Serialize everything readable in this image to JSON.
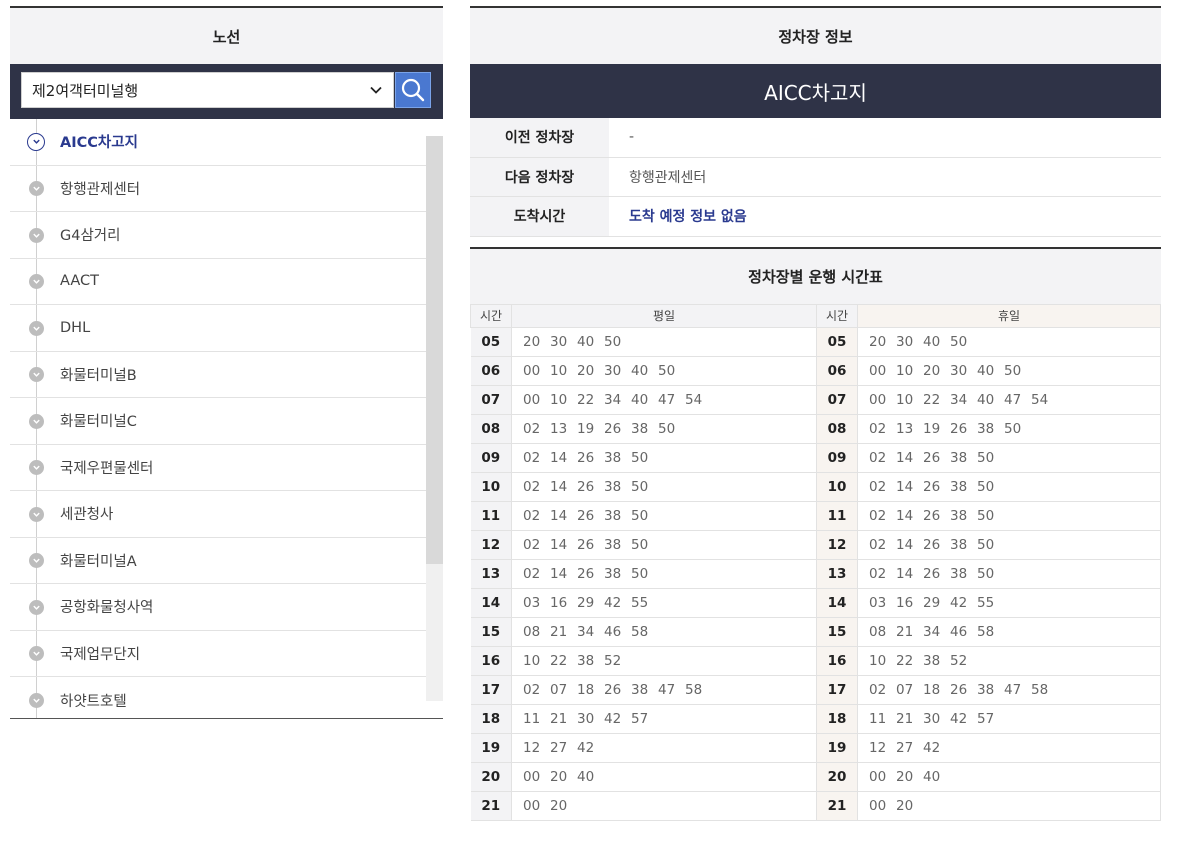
{
  "left": {
    "title": "노선",
    "route_select": "제2여객터미널행",
    "stops": [
      {
        "label": "AICC차고지",
        "active": true
      },
      {
        "label": "항행관제센터"
      },
      {
        "label": "G4삼거리"
      },
      {
        "label": "AACT"
      },
      {
        "label": "DHL"
      },
      {
        "label": "화물터미널B"
      },
      {
        "label": "화물터미널C"
      },
      {
        "label": "국제우편물센터"
      },
      {
        "label": "세관청사"
      },
      {
        "label": "화물터미널A"
      },
      {
        "label": "공항화물청사역"
      },
      {
        "label": "국제업무단지"
      },
      {
        "label": "하얏트호텔"
      }
    ]
  },
  "right": {
    "title": "정차장 정보",
    "stop_name": "AICC차고지",
    "info": [
      {
        "key": "이전 정차장",
        "value": "-"
      },
      {
        "key": "다음 정차장",
        "value": "항행관제센터"
      },
      {
        "key": "도착시간",
        "value": "도착 예정 정보 없음",
        "accent": true
      }
    ],
    "timetable_title": "정차장별 운행 시간표",
    "col_hour": "시간",
    "col_weekday": "평일",
    "col_holiday": "휴일",
    "rows": [
      {
        "hour": "05",
        "weekday": [
          "20",
          "30",
          "40",
          "50"
        ],
        "holiday": [
          "20",
          "30",
          "40",
          "50"
        ]
      },
      {
        "hour": "06",
        "weekday": [
          "00",
          "10",
          "20",
          "30",
          "40",
          "50"
        ],
        "holiday": [
          "00",
          "10",
          "20",
          "30",
          "40",
          "50"
        ]
      },
      {
        "hour": "07",
        "weekday": [
          "00",
          "10",
          "22",
          "34",
          "40",
          "47",
          "54"
        ],
        "holiday": [
          "00",
          "10",
          "22",
          "34",
          "40",
          "47",
          "54"
        ]
      },
      {
        "hour": "08",
        "weekday": [
          "02",
          "13",
          "19",
          "26",
          "38",
          "50"
        ],
        "holiday": [
          "02",
          "13",
          "19",
          "26",
          "38",
          "50"
        ]
      },
      {
        "hour": "09",
        "weekday": [
          "02",
          "14",
          "26",
          "38",
          "50"
        ],
        "holiday": [
          "02",
          "14",
          "26",
          "38",
          "50"
        ]
      },
      {
        "hour": "10",
        "weekday": [
          "02",
          "14",
          "26",
          "38",
          "50"
        ],
        "holiday": [
          "02",
          "14",
          "26",
          "38",
          "50"
        ]
      },
      {
        "hour": "11",
        "weekday": [
          "02",
          "14",
          "26",
          "38",
          "50"
        ],
        "holiday": [
          "02",
          "14",
          "26",
          "38",
          "50"
        ]
      },
      {
        "hour": "12",
        "weekday": [
          "02",
          "14",
          "26",
          "38",
          "50"
        ],
        "holiday": [
          "02",
          "14",
          "26",
          "38",
          "50"
        ]
      },
      {
        "hour": "13",
        "weekday": [
          "02",
          "14",
          "26",
          "38",
          "50"
        ],
        "holiday": [
          "02",
          "14",
          "26",
          "38",
          "50"
        ]
      },
      {
        "hour": "14",
        "weekday": [
          "03",
          "16",
          "29",
          "42",
          "55"
        ],
        "holiday": [
          "03",
          "16",
          "29",
          "42",
          "55"
        ]
      },
      {
        "hour": "15",
        "weekday": [
          "08",
          "21",
          "34",
          "46",
          "58"
        ],
        "holiday": [
          "08",
          "21",
          "34",
          "46",
          "58"
        ]
      },
      {
        "hour": "16",
        "weekday": [
          "10",
          "22",
          "38",
          "52"
        ],
        "holiday": [
          "10",
          "22",
          "38",
          "52"
        ]
      },
      {
        "hour": "17",
        "weekday": [
          "02",
          "07",
          "18",
          "26",
          "38",
          "47",
          "58"
        ],
        "holiday": [
          "02",
          "07",
          "18",
          "26",
          "38",
          "47",
          "58"
        ]
      },
      {
        "hour": "18",
        "weekday": [
          "11",
          "21",
          "30",
          "42",
          "57"
        ],
        "holiday": [
          "11",
          "21",
          "30",
          "42",
          "57"
        ]
      },
      {
        "hour": "19",
        "weekday": [
          "12",
          "27",
          "42"
        ],
        "holiday": [
          "12",
          "27",
          "42"
        ]
      },
      {
        "hour": "20",
        "weekday": [
          "00",
          "20",
          "40"
        ],
        "holiday": [
          "00",
          "20",
          "40"
        ]
      },
      {
        "hour": "21",
        "weekday": [
          "00",
          "20"
        ],
        "holiday": [
          "00",
          "20"
        ]
      }
    ]
  },
  "icons": {
    "search": "search-icon",
    "dropdown": "chevron-down-icon",
    "stop_marker": "chevron-down-circle-icon"
  },
  "colors": {
    "navy": "#2f3347",
    "accent_blue": "#2a3a8f",
    "search_button": "#4a78d0"
  }
}
